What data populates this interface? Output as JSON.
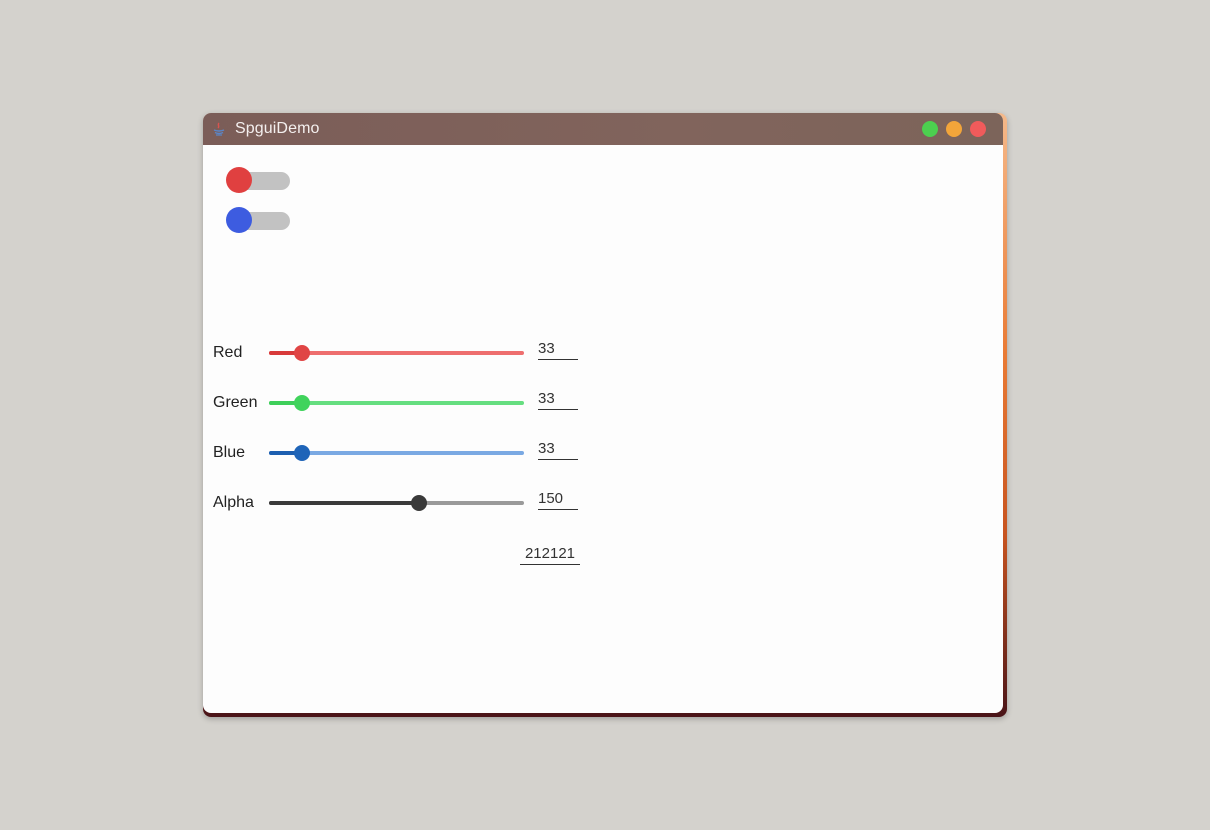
{
  "window": {
    "title": "SpguiDemo",
    "controls": {
      "maximize_color": "#4cd04f",
      "minimize_color": "#f2a53a",
      "close_color": "#f05b5b"
    }
  },
  "toggles": [
    {
      "name": "red-toggle",
      "on": false,
      "knob_color": "#e04040"
    },
    {
      "name": "blue-toggle",
      "on": false,
      "knob_color": "#3d5ce0"
    }
  ],
  "sliders": [
    {
      "label": "Red",
      "value": "33",
      "level": 33,
      "max": 255,
      "active_color": "#d83a3a",
      "rail_color": "#ee6e6e",
      "thumb_color": "#e04545"
    },
    {
      "label": "Green",
      "value": "33",
      "level": 33,
      "max": 255,
      "active_color": "#3ecf5a",
      "rail_color": "#66de80",
      "thumb_color": "#40d35c"
    },
    {
      "label": "Blue",
      "value": "33",
      "level": 33,
      "max": 255,
      "active_color": "#1d5fb0",
      "rail_color": "#7aa9e3",
      "thumb_color": "#1f64b8"
    },
    {
      "label": "Alpha",
      "value": "150",
      "level": 150,
      "max": 255,
      "active_color": "#3a3a3a",
      "rail_color": "#9a9a9a",
      "thumb_color": "#3a3a3a"
    }
  ],
  "hex_value": "212121"
}
